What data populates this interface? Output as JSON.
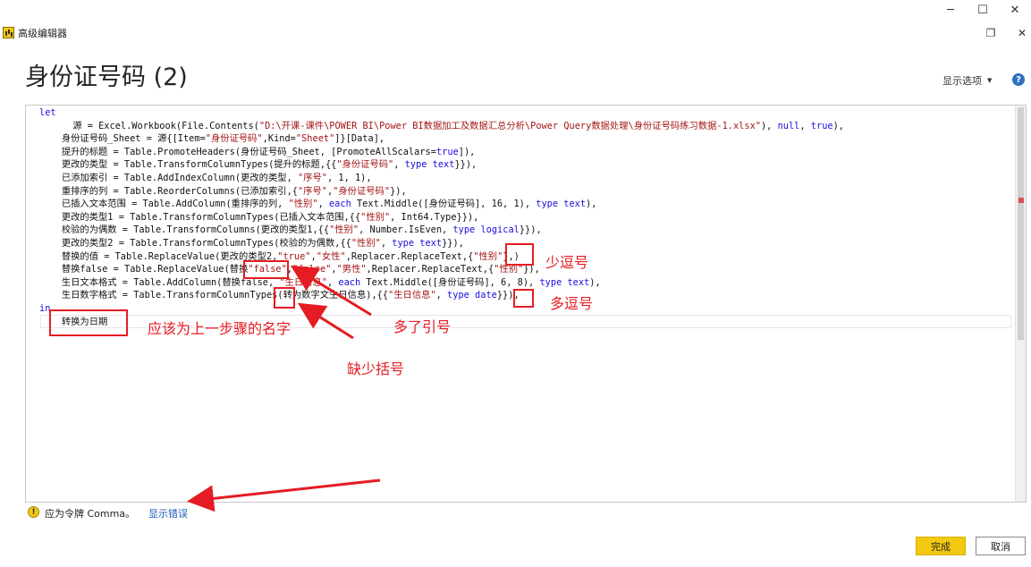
{
  "window": {
    "minimize": "─",
    "maximize": "☐",
    "close": "✕"
  },
  "dialog": {
    "title": "高级编辑器",
    "restore": "❐",
    "close": "✕",
    "query_name": "身份证号码 (2)",
    "display_options": "显示选项",
    "help": "?"
  },
  "code": [
    {
      "i": "",
      "t": [
        {
          "k": "kw",
          "s": "let"
        }
      ]
    },
    {
      "i": "      ",
      "t": [
        {
          "s": "源 = Excel.Workbook(File.Contents("
        },
        {
          "k": "str",
          "s": "\"D:\\开课-课件\\POWER BI\\Power BI数据加工及数据汇总分析\\Power Query数据处理\\身份证号码练习数据-1.xlsx\""
        },
        {
          "s": "), "
        },
        {
          "k": "kw",
          "s": "null"
        },
        {
          "s": ", "
        },
        {
          "k": "kw",
          "s": "true"
        },
        {
          "s": "),"
        }
      ]
    },
    {
      "i": "    ",
      "t": [
        {
          "s": "身份证号码_Sheet = 源{[Item="
        },
        {
          "k": "str",
          "s": "\"身份证号码\""
        },
        {
          "s": ",Kind="
        },
        {
          "k": "str",
          "s": "\"Sheet\""
        },
        {
          "s": "]}[Data],"
        }
      ]
    },
    {
      "i": "    ",
      "t": [
        {
          "s": "提升的标题 = Table.PromoteHeaders(身份证号码_Sheet, [PromoteAllScalars="
        },
        {
          "k": "kw",
          "s": "true"
        },
        {
          "s": "]),"
        }
      ]
    },
    {
      "i": "    ",
      "t": [
        {
          "s": "更改的类型 = Table.TransformColumnTypes(提升的标题,{{"
        },
        {
          "k": "str",
          "s": "\"身份证号码\""
        },
        {
          "s": ", "
        },
        {
          "k": "kw",
          "s": "type text"
        },
        {
          "s": "}}),"
        }
      ]
    },
    {
      "i": "    ",
      "t": [
        {
          "s": "已添加索引 = Table.AddIndexColumn(更改的类型, "
        },
        {
          "k": "str",
          "s": "\"序号\""
        },
        {
          "s": ", 1, 1),"
        }
      ]
    },
    {
      "i": "    ",
      "t": [
        {
          "s": "重排序的列 = Table.ReorderColumns(已添加索引,{"
        },
        {
          "k": "str",
          "s": "\"序号\""
        },
        {
          "s": ","
        },
        {
          "k": "str",
          "s": "\"身份证号码\""
        },
        {
          "s": "}),"
        }
      ]
    },
    {
      "i": "    ",
      "t": [
        {
          "s": "已插入文本范围 = Table.AddColumn(重排序的列, "
        },
        {
          "k": "str",
          "s": "\"性别\""
        },
        {
          "s": ", "
        },
        {
          "k": "kw",
          "s": "each"
        },
        {
          "s": " Text.Middle([身份证号码], 16, 1), "
        },
        {
          "k": "kw",
          "s": "type text"
        },
        {
          "s": "),"
        }
      ]
    },
    {
      "i": "    ",
      "t": [
        {
          "s": "更改的类型1 = Table.TransformColumnTypes(已插入文本范围,{{"
        },
        {
          "k": "str",
          "s": "\"性别\""
        },
        {
          "s": ", Int64.Type}}),"
        }
      ]
    },
    {
      "i": "    ",
      "t": [
        {
          "s": "校验的为偶数 = Table.TransformColumns(更改的类型1,{{"
        },
        {
          "k": "str",
          "s": "\"性别\""
        },
        {
          "s": ", Number.IsEven, "
        },
        {
          "k": "kw",
          "s": "type logical"
        },
        {
          "s": "}}),"
        }
      ]
    },
    {
      "i": "    ",
      "t": [
        {
          "s": "更改的类型2 = Table.TransformColumnTypes(校验的为偶数,{{"
        },
        {
          "k": "str",
          "s": "\"性别\""
        },
        {
          "s": ", "
        },
        {
          "k": "kw",
          "s": "type text"
        },
        {
          "s": "}}),"
        }
      ]
    },
    {
      "i": "    ",
      "t": [
        {
          "s": "替换的值 = Table.ReplaceValue(更改的类型2,"
        },
        {
          "k": "str",
          "s": "\"true\""
        },
        {
          "s": ","
        },
        {
          "k": "str",
          "s": "\"女性\""
        },
        {
          "s": ",Replacer.ReplaceText,{"
        },
        {
          "k": "str",
          "s": "\"性别\""
        },
        {
          "s": "},)"
        }
      ]
    },
    {
      "i": "    ",
      "t": [
        {
          "s": "替换false = Table.ReplaceValue(替换"
        },
        {
          "k": "str",
          "s": "\"false\""
        },
        {
          "s": ","
        },
        {
          "k": "str",
          "s": "\"false\""
        },
        {
          "s": ","
        },
        {
          "k": "str",
          "s": "\"男性\""
        },
        {
          "s": ",Replacer.ReplaceText,{"
        },
        {
          "k": "str",
          "s": "\"性别\""
        },
        {
          "s": "}),"
        }
      ]
    },
    {
      "i": "    ",
      "t": [
        {
          "s": "生日文本格式 = Table.AddColumn(替换false, "
        },
        {
          "k": "str",
          "s": "\"生日信息\""
        },
        {
          "s": ", "
        },
        {
          "k": "kw",
          "s": "each"
        },
        {
          "s": " Text.Middle([身份证号码], 6, 8), "
        },
        {
          "k": "kw",
          "s": "type text"
        },
        {
          "s": "),"
        }
      ]
    },
    {
      "i": "    ",
      "t": [
        {
          "s": "生日数字格式 = Table.TransformColumnTypes(转为数字文生日信息),{{"
        },
        {
          "k": "str",
          "s": "\"生日信息\""
        },
        {
          "s": ", "
        },
        {
          "k": "kw",
          "s": "type date"
        },
        {
          "s": "}}),"
        }
      ]
    },
    {
      "i": "",
      "t": [
        {
          "k": "kw",
          "s": "in"
        }
      ]
    },
    {
      "i": "    ",
      "t": [
        {
          "s": "转换为日期"
        }
      ]
    }
  ],
  "annotations": {
    "missing_comma": "少逗号",
    "extra_comma": "多逗号",
    "extra_quote": "多了引号",
    "missing_paren": "缺少括号",
    "should_be_step_name": "应该为上一步骤的名字"
  },
  "status": {
    "warning_icon": "!",
    "message": "应为令牌 Comma。",
    "show_error": "显示错误"
  },
  "buttons": {
    "done": "完成",
    "cancel": "取消"
  },
  "colors": {
    "accent": "#f2c811",
    "annotation": "#e51c23",
    "keyword": "#1a0fe0",
    "string": "#a31515",
    "link": "#1b5fb6"
  }
}
